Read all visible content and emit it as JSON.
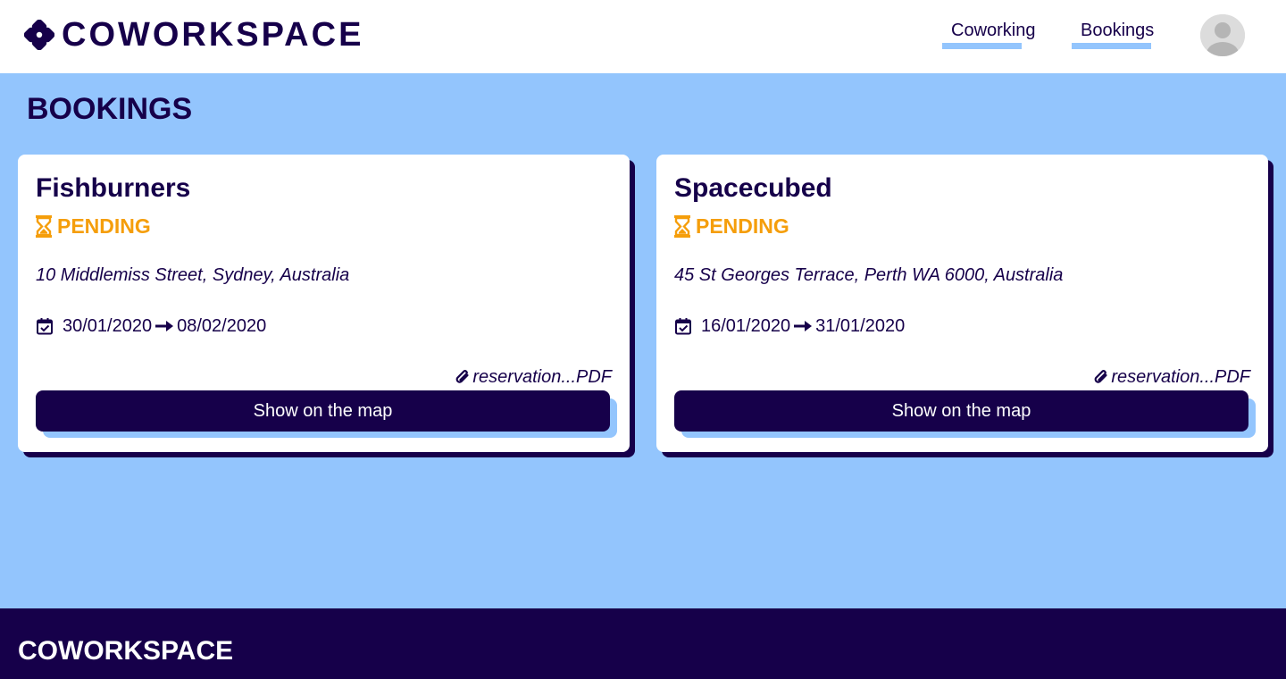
{
  "header": {
    "brand": "COWORKSPACE",
    "nav": [
      {
        "label": "Coworking"
      },
      {
        "label": "Bookings"
      }
    ]
  },
  "main": {
    "title": "BOOKINGS",
    "bookings": [
      {
        "name": "Fishburners",
        "status": "PENDING",
        "address": "10 Middlemiss Street, Sydney, Australia",
        "start_date": "30/01/2020",
        "end_date": "08/02/2020",
        "attachment": "reservation...PDF",
        "map_button": "Show on the map"
      },
      {
        "name": "Spacecubed",
        "status": "PENDING",
        "address": "45 St Georges Terrace, Perth WA 6000, Australia",
        "start_date": "16/01/2020",
        "end_date": "31/01/2020",
        "attachment": "reservation...PDF",
        "map_button": "Show on the map"
      }
    ]
  },
  "footer": {
    "brand": "COWORKSPACE"
  },
  "colors": {
    "navy": "#16004a",
    "light_blue": "#93c5fd",
    "pending": "#f59e0b",
    "white": "#ffffff"
  },
  "icons": {
    "brand_logo": "coworkspace-logo-icon",
    "status": "hourglass-icon",
    "dates": "calendar-check-icon",
    "date_separator": "arrow-right-icon",
    "attachment": "paperclip-icon",
    "profile": "user-avatar-icon"
  }
}
